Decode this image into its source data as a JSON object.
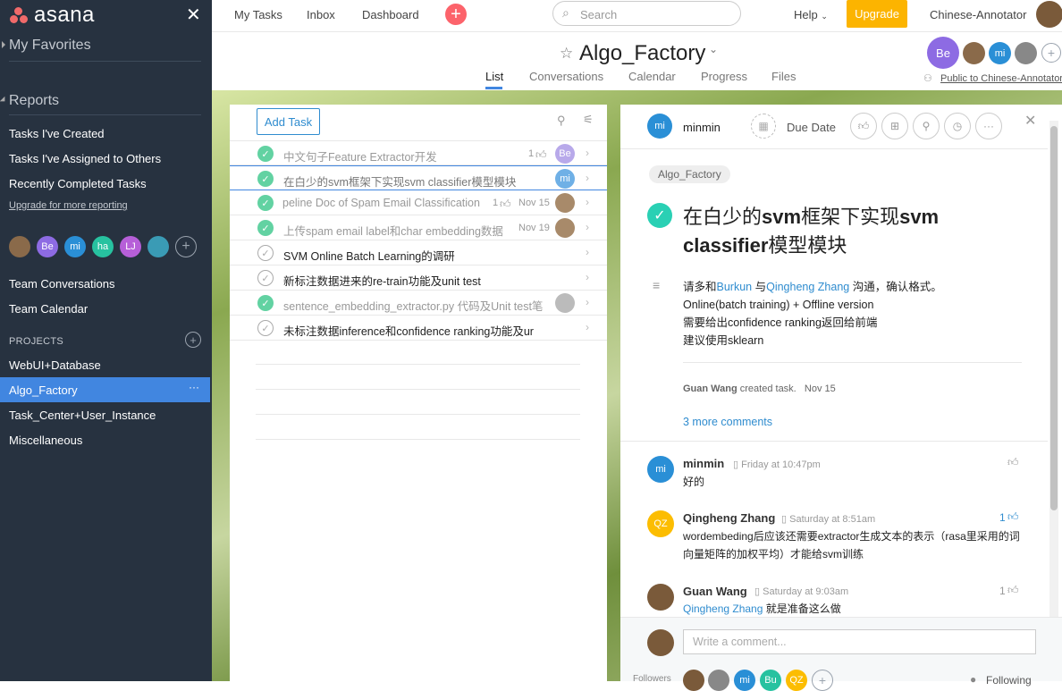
{
  "sidebar": {
    "brand": "asana",
    "my_favorites": "My Favorites",
    "reports": "Reports",
    "report_items": [
      "Tasks I've Created",
      "Tasks I've Assigned to Others",
      "Recently Completed Tasks"
    ],
    "upgrade_link": "Upgrade for more reporting",
    "team_members": [
      "Be",
      "mi",
      "ha",
      "LJ"
    ],
    "team_conversations": "Team Conversations",
    "team_calendar": "Team Calendar",
    "projects_label": "PROJECTS",
    "projects": [
      "WebUI+Database",
      "Algo_Factory",
      "Task_Center+User_Instance",
      "Miscellaneous"
    ],
    "active_more": "···"
  },
  "topbar": {
    "nav": [
      "My Tasks",
      "Inbox",
      "Dashboard"
    ],
    "search_placeholder": "Search",
    "help": "Help",
    "upgrade": "Upgrade",
    "user": "Chinese-Annotator"
  },
  "project": {
    "title": "Algo_Factory",
    "tabs": [
      "List",
      "Conversations",
      "Calendar",
      "Progress",
      "Files"
    ],
    "members": [
      "Be",
      "mi"
    ],
    "visibility": "Public to Chinese-Annotator"
  },
  "tasklist": {
    "add_task": "Add Task",
    "tasks": [
      {
        "name": "中文句子Feature Extractor开发",
        "done": true,
        "likes": "1",
        "date": "",
        "avatar": "Be"
      },
      {
        "name": "在白少的svm框架下实现svm classifier模型模块",
        "done": true,
        "likes": "",
        "date": "",
        "avatar": "mi"
      },
      {
        "name": "peline Doc of Spam Email Classification",
        "done": true,
        "likes": "1",
        "date": "Nov 15",
        "avatar": "photo"
      },
      {
        "name": "上传spam email label和char embedding数据",
        "done": true,
        "likes": "",
        "date": "Nov 19",
        "avatar": "photo"
      },
      {
        "name": "SVM Online Batch Learning的调研",
        "done": false,
        "likes": "",
        "date": "",
        "avatar": ""
      },
      {
        "name": "新标注数据进来的re-train功能及unit test",
        "done": false,
        "likes": "",
        "date": "",
        "avatar": ""
      },
      {
        "name": "sentence_embedding_extractor.py 代码及Unit test笔",
        "done": true,
        "likes": "",
        "date": "",
        "avatar": "photo"
      },
      {
        "name": "未标注数据inference和confidence ranking功能及ur",
        "done": false,
        "likes": "",
        "date": "",
        "avatar": ""
      }
    ]
  },
  "detail": {
    "assignee": "minmin",
    "assignee_initials": "mi",
    "due_date": "Due Date",
    "project_tag": "Algo_Factory",
    "title_part1": "在白少的",
    "title_bold1": "svm",
    "title_part2": "框架下实现",
    "title_bold2": "svm",
    "title_line2_bold": "classifier",
    "title_line2": "模型模块",
    "desc_line1_a": "请多和",
    "desc_link1": "Burkun",
    "desc_line1_b": " 与",
    "desc_link2": "Qingheng Zhang",
    "desc_line1_c": " 沟通，确认格式。",
    "desc_line2": "Online(batch training) + Offline version",
    "desc_line3": "需要给出confidence ranking返回给前端",
    "desc_line4": "建议使用sklearn",
    "created_by": "Guan Wang",
    "created_text": "created task.",
    "created_date": "Nov 15",
    "more_comments": "3 more comments",
    "comments": [
      {
        "author": "minmin",
        "initials": "mi",
        "time": "Friday at 10:47pm",
        "text": "好的",
        "likes": ""
      },
      {
        "author": "Qingheng Zhang",
        "initials": "QZ",
        "time": "Saturday at 8:51am",
        "text": "wordembeding后应该还需要extractor生成文本的表示（rasa里采用的词向量矩阵的加权平均）才能给svm训练",
        "likes": "1"
      },
      {
        "author": "Guan Wang",
        "initials": "",
        "time": "Saturday at 9:03am",
        "text_link": "Qingheng Zhang",
        "text": " 就是准备这么做",
        "likes": "1"
      }
    ],
    "comment_placeholder": "Write a comment...",
    "followers_label": "Followers",
    "followers": [
      "mi",
      "Bu",
      "QZ"
    ],
    "following": "Following"
  },
  "colors": {
    "sidebar": "#273240",
    "active": "#4186e0",
    "accent": "#fc636b",
    "upgrade": "#fcb400",
    "link": "#2f8ccf",
    "done": "#62d2a2"
  }
}
